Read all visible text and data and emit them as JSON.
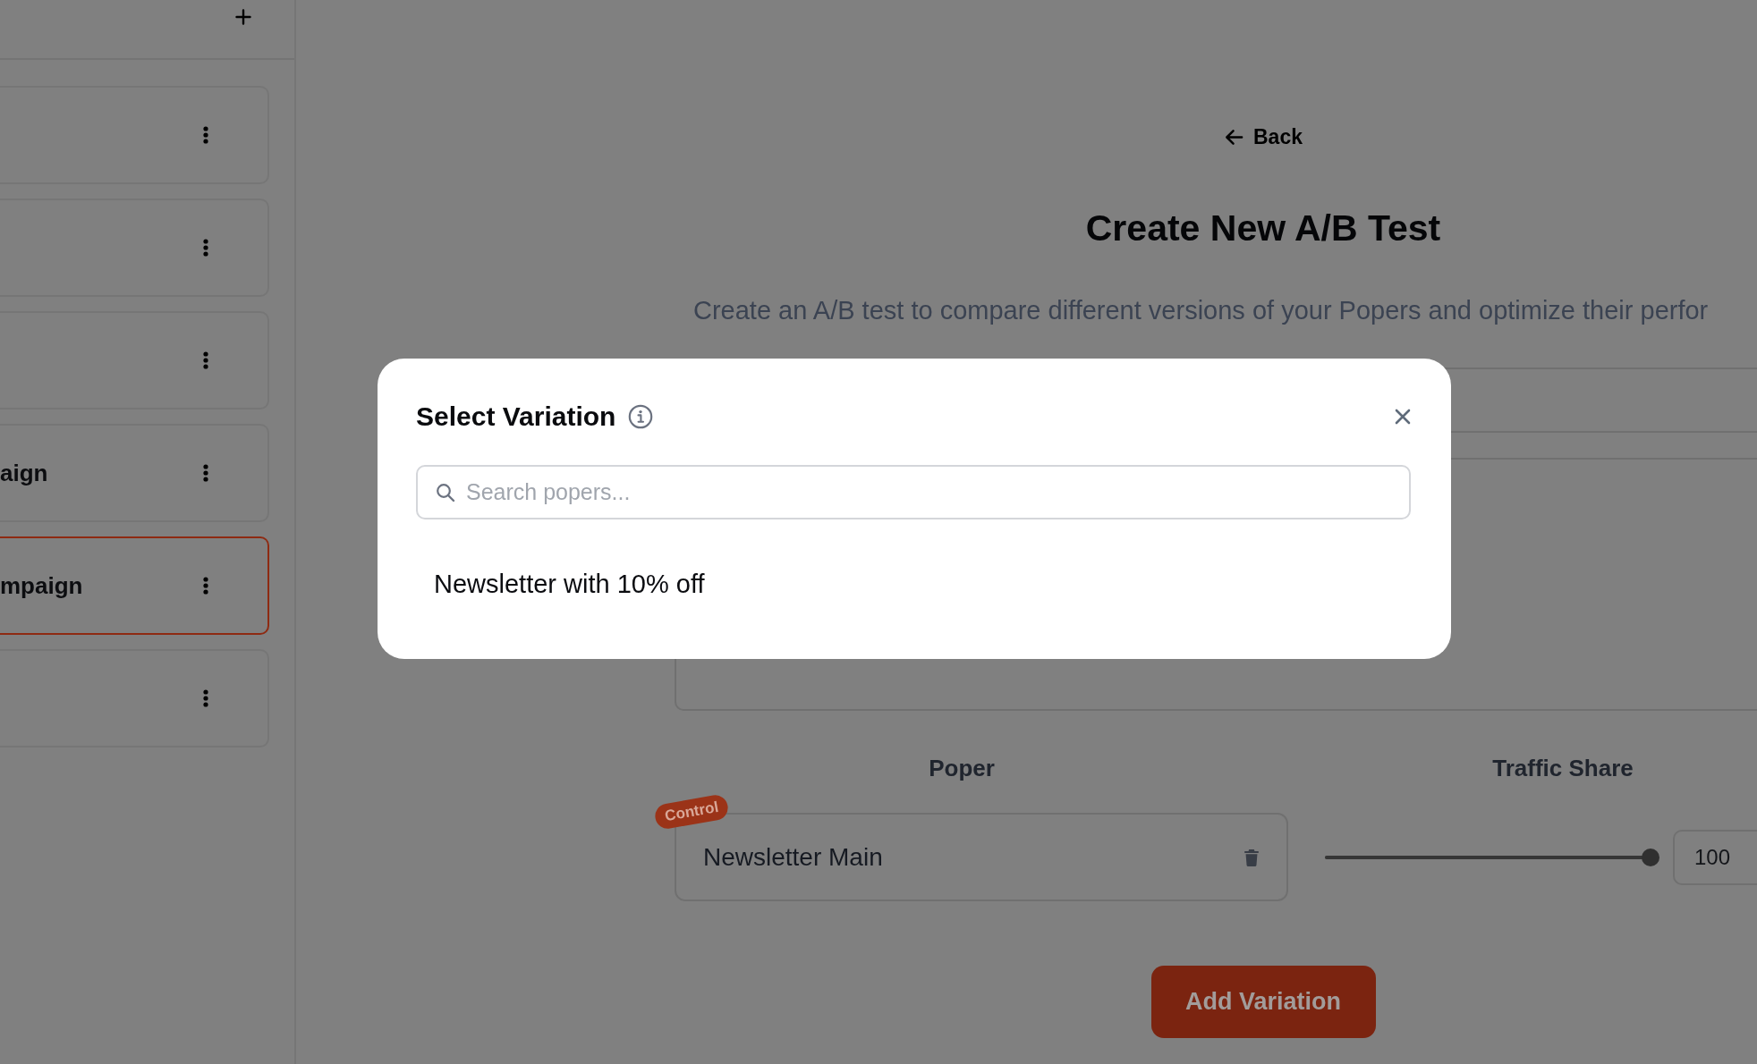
{
  "sidebar": {
    "items": [
      {
        "selected": false
      },
      {
        "selected": false
      },
      {
        "selected": false
      },
      {
        "label": "aign",
        "selected": false
      },
      {
        "label": "mpaign",
        "selected": true
      },
      {
        "selected": false
      }
    ]
  },
  "main": {
    "back_link": "Back",
    "title": "Create New A/B Test",
    "subtitle": "Create an A/B test to compare different versions of your Popers and optimize their perfor",
    "fields": [
      {
        "kind": "input"
      },
      {
        "kind": "textarea"
      }
    ],
    "columns": [
      "Poper",
      "Traffic Share"
    ],
    "variations": [
      {
        "name": "Newsletter Main",
        "badge": "Control",
        "level": 1,
        "share": "100"
      }
    ],
    "add_button": "Add Variation"
  },
  "modal": {
    "title": "Select Variation",
    "search": {
      "placeholder": "Search popers..."
    },
    "results": [
      "Newsletter with 10% off"
    ]
  }
}
